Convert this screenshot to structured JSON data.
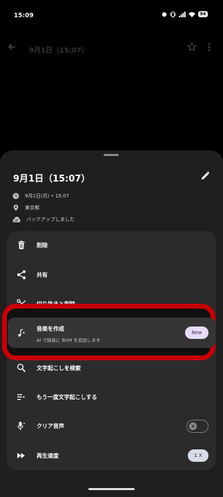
{
  "status_bar": {
    "time": "15:09",
    "battery": "94"
  },
  "background": {
    "title": "9月1日（15:07）"
  },
  "sheet": {
    "title": "9月1日（15:07）",
    "meta": [
      {
        "icon": "clock-icon",
        "text": "9月1日(月) • 15:07"
      },
      {
        "icon": "location-icon",
        "text": "東京都"
      },
      {
        "icon": "cloud-done-icon",
        "text": "バックアップしました"
      }
    ]
  },
  "menu": {
    "delete": "削除",
    "share": "共有",
    "trim": "切り抜きと削除",
    "create_music": {
      "title": "音楽を作成",
      "subtitle": "AI で録音に BGM を追加します",
      "badge": "New"
    },
    "search_transcript": "文字起こしを検索",
    "retranscribe": "もう一度文字起こしする",
    "clear_voice": "クリア音声",
    "playback_speed": {
      "label": "再生速度",
      "value": "1 X"
    }
  },
  "colors": {
    "highlight_border": "#c60006",
    "sheet_bg": "#1f1f1f",
    "card_bg": "#2b2b2b"
  }
}
